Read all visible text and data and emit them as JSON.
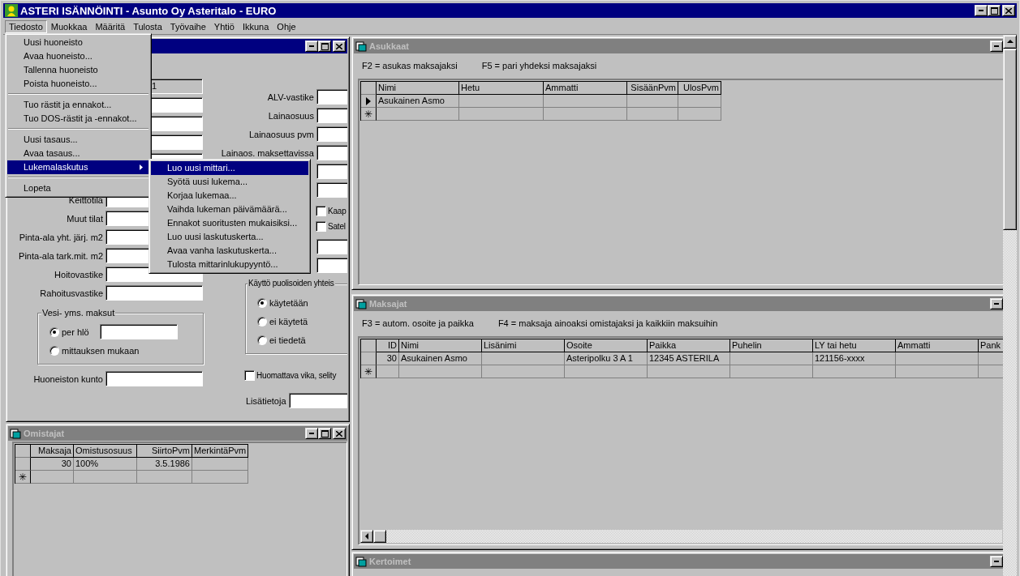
{
  "app": {
    "title": "ASTERI ISÄNNÖINTI - Asunto Oy Asteritalo - EURO"
  },
  "menubar": [
    {
      "label": "Tiedosto",
      "selected": true
    },
    {
      "label": "Muokkaa",
      "selected": false
    },
    {
      "label": "Määritä",
      "selected": false
    },
    {
      "label": "Tulosta",
      "selected": false
    },
    {
      "label": "Työvaihe",
      "selected": false
    },
    {
      "label": "Yhtiö",
      "selected": false
    },
    {
      "label": "Ikkuna",
      "selected": false
    },
    {
      "label": "Ohje",
      "selected": false
    }
  ],
  "file_menu": [
    {
      "kind": "item",
      "label": "Uusi huoneisto",
      "selected": false
    },
    {
      "kind": "item",
      "label": "Avaa huoneisto...",
      "selected": false
    },
    {
      "kind": "item",
      "label": "Tallenna huoneisto",
      "selected": false
    },
    {
      "kind": "item",
      "label": "Poista huoneisto...",
      "selected": false
    },
    {
      "kind": "separator"
    },
    {
      "kind": "item",
      "label": "Tuo rästit ja ennakot...",
      "selected": false
    },
    {
      "kind": "item",
      "label": "Tuo DOS-rästit ja -ennakot...",
      "selected": false
    },
    {
      "kind": "separator"
    },
    {
      "kind": "item",
      "label": "Uusi tasaus...",
      "selected": false
    },
    {
      "kind": "item",
      "label": "Avaa tasaus...",
      "selected": false
    },
    {
      "kind": "submenu",
      "label": "Lukemalaskutus",
      "selected": true
    },
    {
      "kind": "separator"
    },
    {
      "kind": "item",
      "label": "Lopeta",
      "selected": false
    }
  ],
  "submenu": [
    {
      "label": "Luo uusi mittari...",
      "selected": true
    },
    {
      "label": "Syötä uusi lukema...",
      "selected": false
    },
    {
      "label": "Korjaa lukemaa...",
      "selected": false
    },
    {
      "label": "Vaihda lukeman päivämäärä...",
      "selected": false
    },
    {
      "label": "Ennakot suoritusten mukaisiksi...",
      "selected": false
    },
    {
      "label": "Luo uusi laskutuskerta...",
      "selected": false
    },
    {
      "label": "Avaa vanha laskutuskerta...",
      "selected": false
    },
    {
      "label": "Tulosta mittarinlukupyyntö...",
      "selected": false
    }
  ],
  "apartment_window": {
    "active": true,
    "top_fields": [
      {
        "kind": "readonly",
        "value": "1"
      },
      {
        "kind": "field"
      },
      {
        "kind": "field"
      },
      {
        "kind": "field"
      },
      {
        "kind": "field"
      }
    ],
    "fields": [
      {
        "kind": "field",
        "label": "Keittotila"
      },
      {
        "kind": "field",
        "label": "Muut tilat"
      },
      {
        "kind": "field",
        "label": "Pinta-ala yht. järj. m2"
      },
      {
        "kind": "field",
        "label": "Pinta-ala tark.mit. m2"
      },
      {
        "kind": "field",
        "label": "Hoitovastike"
      },
      {
        "kind": "field",
        "label": "Rahoitusvastike"
      }
    ],
    "water_group": {
      "legend": "Vesi- yms. maksut",
      "options": [
        {
          "label": "per hlö",
          "selected": true,
          "has_field": true
        },
        {
          "label": "mittauksen mukaan",
          "selected": false,
          "has_field": false
        }
      ]
    },
    "condition_field": {
      "label": "Huoneiston kunto"
    },
    "right_fields": [
      {
        "kind": "field",
        "label": "ALV-vastike"
      },
      {
        "kind": "field",
        "label": "Lainaosuus"
      },
      {
        "kind": "field",
        "label": "Lainaosuus pvm"
      },
      {
        "kind": "field",
        "label": "Lainaos. maksettavissa"
      },
      {
        "kind": "field"
      },
      {
        "kind": "field"
      }
    ],
    "checkboxes": [
      {
        "label": "Kaap",
        "checked": false
      },
      {
        "label": "Satel",
        "checked": false
      }
    ],
    "more_fields": [
      {
        "kind": "field"
      },
      {
        "kind": "field"
      }
    ],
    "spouse_group": {
      "legend": "Käyttö puolisoiden yhteis",
      "options": [
        {
          "label": "käytetään",
          "selected": true,
          "has_field": false
        },
        {
          "label": "ei käytetä",
          "selected": false,
          "has_field": false
        },
        {
          "label": "ei tiedetä",
          "selected": false,
          "has_field": false
        }
      ]
    },
    "defect_checkbox": {
      "label": "Huomattava vika, selity",
      "checked": false
    },
    "notes_field": {
      "label": "Lisätietoja"
    }
  },
  "owners_window": {
    "title": "Omistajat",
    "active": false,
    "grid": {
      "columns": [
        "Maksaja",
        "Omistusosuus",
        "SiirtoPvm",
        "MerkintäPvm"
      ],
      "rows": [
        {
          "current": false,
          "cells": [
            "30",
            "100%",
            "3.5.1986"
          ]
        }
      ],
      "new_row_marker": "✳"
    }
  },
  "residents_window": {
    "title": "Asukkaat",
    "active": false,
    "hints": [
      "F2 = asukas maksajaksi",
      "F5 = pari yhdeksi maksajaksi"
    ],
    "grid": {
      "columns": [
        "Nimi",
        "Hetu",
        "Ammatti",
        "SisäänPvm",
        "UlosPvm"
      ],
      "rows": [
        {
          "current": true,
          "cells": [
            "Asukainen Asmo"
          ]
        }
      ],
      "new_row_marker": "✳"
    }
  },
  "payers_window": {
    "title": "Maksajat",
    "active": false,
    "hints": [
      "F3 = autom. osoite ja paikka",
      "F4 = maksaja ainoaksi omistajaksi ja kaikkiin maksuihin"
    ],
    "grid": {
      "columns": [
        "ID",
        "Nimi",
        "Lisänimi",
        "Osoite",
        "Paikka",
        "Puhelin",
        "LY tai hetu",
        "Ammatti",
        "Pank"
      ],
      "rows": [
        {
          "current": false,
          "cells": [
            "30",
            "Asukainen Asmo",
            null,
            "Asteripolku 3 A 1",
            "12345 ASTERILA",
            null,
            "121156-xxxx"
          ]
        }
      ],
      "new_row_marker": "✳"
    }
  },
  "factors_window": {
    "title": "Kertoimet",
    "active": false
  }
}
